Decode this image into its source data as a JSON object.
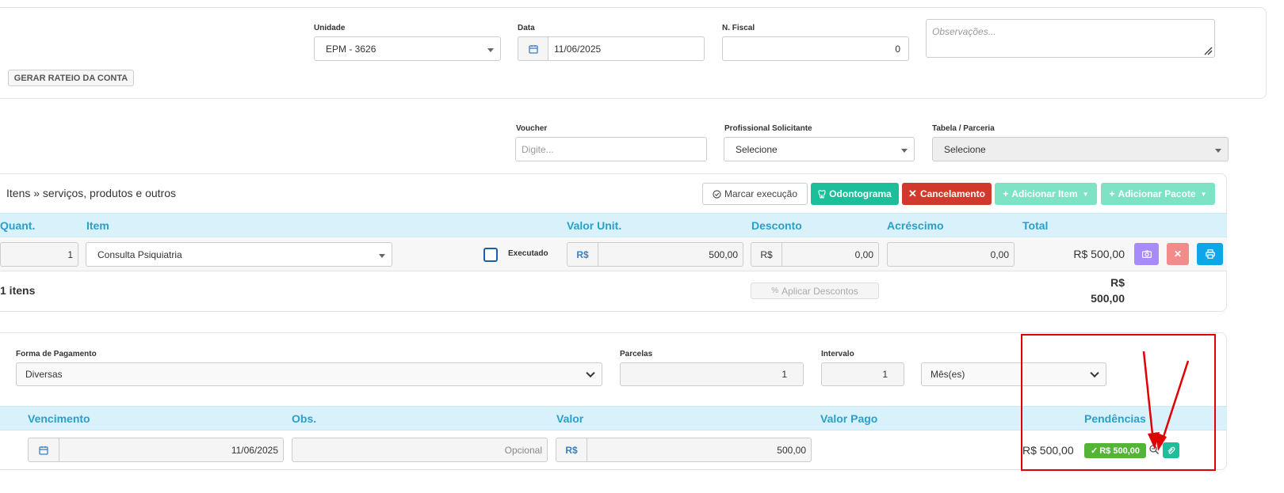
{
  "top": {
    "rateio_button": "GERAR RATEIO DA CONTA",
    "unidade_label": "Unidade",
    "unidade_value": "EPM - 3626",
    "data_label": "Data",
    "data_value": "11/06/2025",
    "nfiscal_label": "N. Fiscal",
    "nfiscal_value": "0",
    "observacoes_placeholder": "Observações..."
  },
  "filters": {
    "voucher_label": "Voucher",
    "voucher_placeholder": "Digite...",
    "profissional_label": "Profissional Solicitante",
    "profissional_value": "Selecione",
    "tabela_label": "Tabela / Parceria",
    "tabela_value": "Selecione"
  },
  "items": {
    "title": "Itens » serviços, produtos e outros",
    "toolbar": {
      "marcar": "Marcar execução",
      "odontograma": "Odontograma",
      "cancelamento": "Cancelamento",
      "adicionar_item": "Adicionar Item",
      "adicionar_pacote": "Adicionar Pacote"
    },
    "headers": [
      "Quant.",
      "Item",
      "Valor Unit.",
      "Desconto",
      "Acréscimo",
      "Total"
    ],
    "row": {
      "quant": "1",
      "item": "Consulta Psiquiatria",
      "executado": "Executado",
      "currency": "R$",
      "valor_unit": "500,00",
      "desconto": "0,00",
      "acrescimo": "0,00",
      "total": "R$ 500,00"
    },
    "footer": {
      "count": "1 itens",
      "aplicar": "Aplicar Descontos",
      "total_line1": "R$",
      "total_line2": "500,00"
    }
  },
  "payment": {
    "forma_label": "Forma de Pagamento",
    "forma_value": "Diversas",
    "parcelas_label": "Parcelas",
    "parcelas_value": "1",
    "intervalo_label": "Intervalo",
    "intervalo_value": "1",
    "periodo_value": "Mês(es)",
    "headers": [
      "Vencimento",
      "Obs.",
      "Valor",
      "Valor Pago",
      "Pendências"
    ],
    "row": {
      "vencimento": "11/06/2025",
      "obs_placeholder": "Opcional",
      "currency": "R$",
      "valor": "500,00",
      "pendencia_total": "R$ 500,00",
      "badge": "R$ 500,00"
    }
  },
  "colors": {
    "accent": "#29a0c8",
    "green": "#1dbf9a",
    "red": "#d0392b",
    "highlight": "#e00000"
  }
}
